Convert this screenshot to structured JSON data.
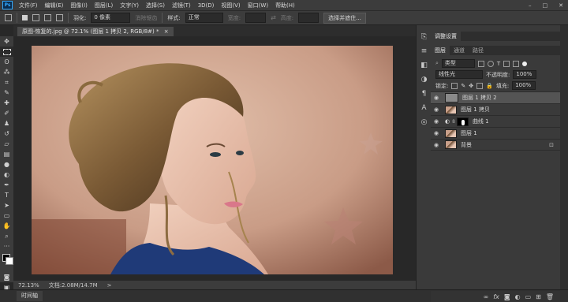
{
  "menubar": {
    "logo": "Ps",
    "items": [
      "文件(F)",
      "编辑(E)",
      "图像(I)",
      "图层(L)",
      "文字(Y)",
      "选择(S)",
      "滤镜(T)",
      "3D(D)",
      "视图(V)",
      "窗口(W)",
      "帮助(H)"
    ],
    "minimize": "–",
    "maximize": "□",
    "close": "✕"
  },
  "options": {
    "feather_label": "羽化:",
    "feather_value": "0 像素",
    "antialias": "消除锯齿",
    "style_label": "样式:",
    "style_value": "正常",
    "width_label": "宽度:",
    "height_label": "高度:",
    "select_mask_button": "选择并遮住..."
  },
  "document": {
    "tab_title": "原图-恢复的.jpg @ 72.1% (图层 1 拷贝 2, RGB/8#) *",
    "tab_close": "×"
  },
  "status": {
    "zoom": "72.13%",
    "doc_info": "文档:2.08M/14.7M",
    "arrow": ">"
  },
  "timeline": {
    "tab": "时间轴"
  },
  "panels": {
    "adjust_tab": "调整设置",
    "tabs": [
      "图层",
      "通道",
      "路径"
    ],
    "kind_label": "类型",
    "blend_mode": "线性光",
    "opacity_label": "不透明度:",
    "opacity_value": "100%",
    "lock_label": "锁定:",
    "fill_label": "填充:",
    "fill_value": "100%",
    "layers": [
      {
        "name": "图层 1 拷贝 2",
        "selected": true,
        "thumb": "gray"
      },
      {
        "name": "图层 1 拷贝",
        "selected": false,
        "thumb": "portrait"
      },
      {
        "name": "曲线 1",
        "selected": false,
        "thumb": "adjust"
      },
      {
        "name": "图层 1",
        "selected": false,
        "thumb": "portrait"
      },
      {
        "name": "背景",
        "selected": false,
        "thumb": "portrait",
        "locked": true
      }
    ],
    "bottom_icons": [
      "link-icon",
      "fx-icon",
      "mask-icon",
      "adjustment-icon",
      "group-icon",
      "new-layer-icon",
      "trash-icon"
    ]
  },
  "colors": {
    "chrome": "#3c3c3c",
    "panel": "#3a3a3a",
    "canvas_bg": "#282828",
    "accent": "#31a8ff",
    "selected_layer": "#545454"
  }
}
